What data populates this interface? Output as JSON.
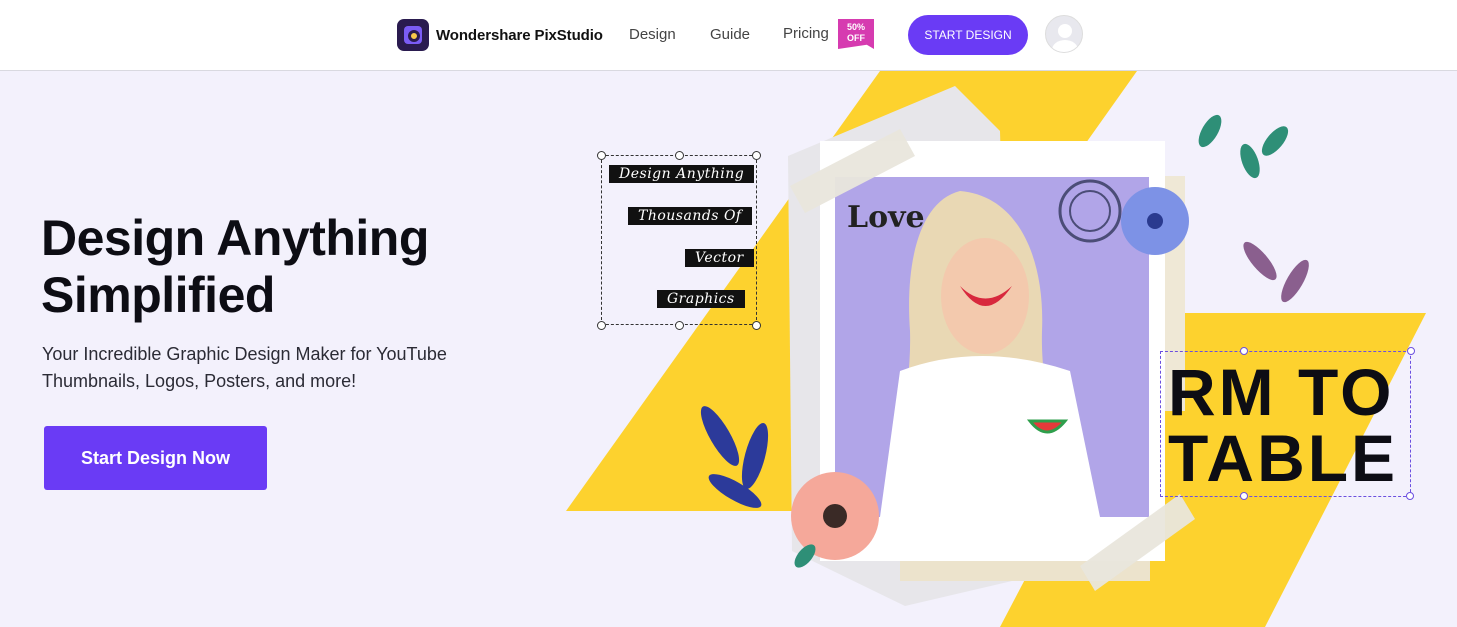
{
  "nav": {
    "brand": "Wondershare PixStudio",
    "links": [
      "Design",
      "Guide",
      "Pricing"
    ],
    "badge_line1": "50%",
    "badge_line2": "OFF",
    "cta": "START DESIGN"
  },
  "hero": {
    "title_line1": "Design Anything",
    "title_line2": "Simplified",
    "subtitle": "Your Incredible Graphic Design Maker for YouTube Thumbnails, Logos, Posters, and more!",
    "cta": "Start Design Now"
  },
  "art": {
    "tags": [
      "Design Anything",
      "Thousands Of",
      "Vector",
      "Graphics"
    ],
    "big_line1": "RM TO",
    "big_line2": "TABLE",
    "newspaper_word": "Love",
    "colors": {
      "yellow": "#fdd22e",
      "purple": "#b1a5e8",
      "accent": "#6a3bf5"
    }
  }
}
